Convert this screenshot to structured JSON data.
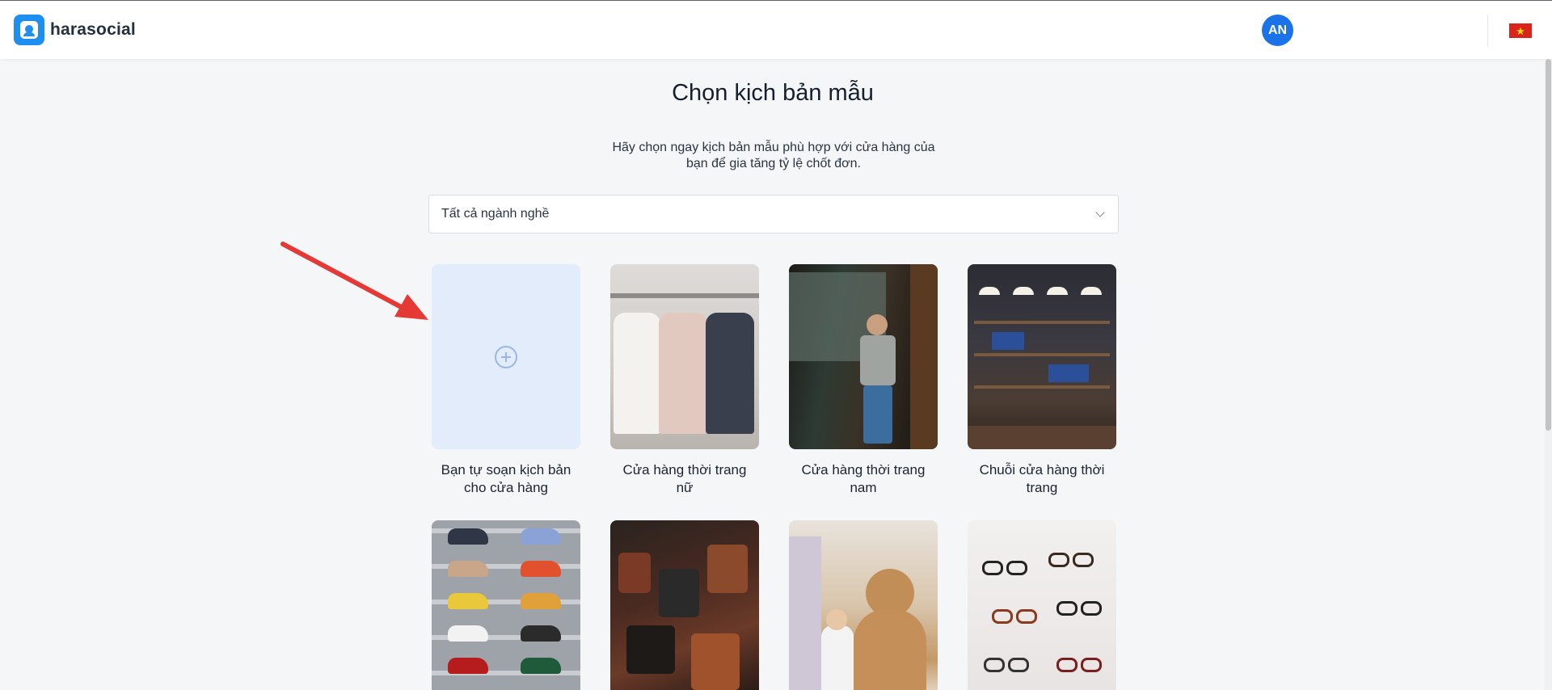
{
  "header": {
    "brand": "harasocial",
    "avatar_initials": "AN",
    "language_flag": "vn-flag-icon",
    "accent_color": "#1a73e8"
  },
  "page": {
    "title": "Chọn kịch bản mẫu",
    "subtitle": "Hãy chọn ngay kịch bản mẫu phù hợp với cửa hàng của bạn để gia tăng tỷ lệ chốt đơn.",
    "industry_select": {
      "selected": "Tất cả ngành nghề"
    }
  },
  "templates": [
    {
      "label": "Bạn tự soạn kịch bản cho cửa hàng",
      "icon": "plus-circle-icon"
    },
    {
      "label": "Cửa hàng thời trang nữ"
    },
    {
      "label": "Cửa hàng thời trang nam"
    },
    {
      "label": "Chuỗi cửa hàng thời trang"
    },
    {
      "label": ""
    },
    {
      "label": ""
    },
    {
      "label": ""
    },
    {
      "label": ""
    }
  ]
}
